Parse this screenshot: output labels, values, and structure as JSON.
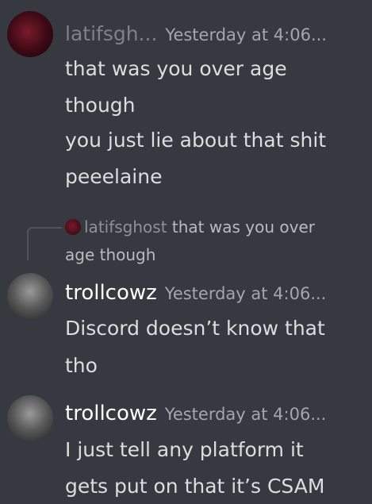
{
  "messages": [
    {
      "username": "latifsgh...",
      "timestamp": "Yesterday at 4:06...",
      "lines": [
        "that was you over age",
        "though",
        "you just lie about that shit",
        "peeelaine"
      ]
    },
    {
      "reply": {
        "username": "latifsghost",
        "text_line1": "that was you over",
        "text_line2": "age though"
      },
      "username": "trollcowz",
      "timestamp": "Yesterday at 4:06...",
      "lines": [
        "Discord doesn’t know that",
        "tho"
      ]
    },
    {
      "username": "trollcowz",
      "timestamp": "Yesterday at 4:06...",
      "lines": [
        "I just tell any platform it",
        "gets put on that it’s CSAM"
      ]
    }
  ]
}
